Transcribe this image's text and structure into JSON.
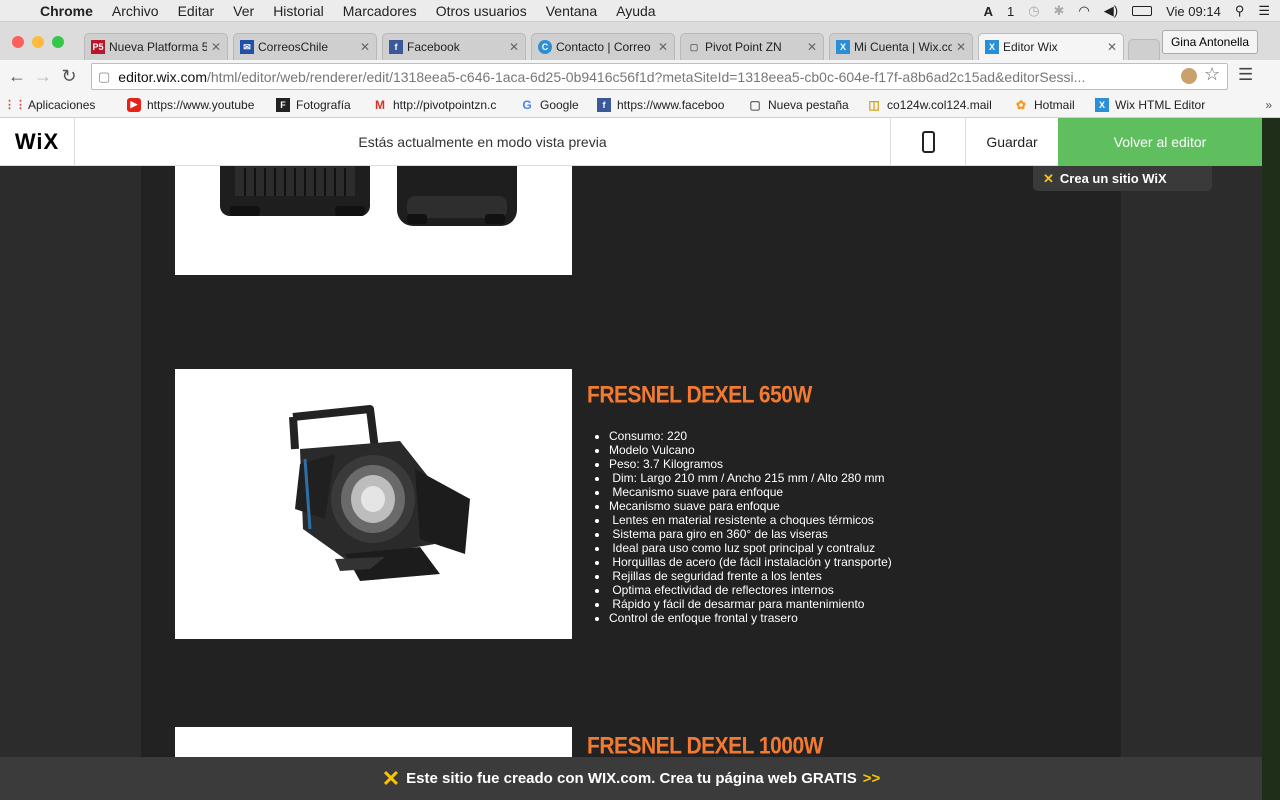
{
  "menubar": {
    "app": "Chrome",
    "items": [
      "Archivo",
      "Editar",
      "Ver",
      "Historial",
      "Marcadores",
      "Otros usuarios",
      "Ventana",
      "Ayuda"
    ],
    "right": {
      "adobe": "1",
      "clock": "Vie 09:14"
    }
  },
  "tabs": [
    {
      "label": "Nueva Platforma 5",
      "fav": "P5",
      "fav_color": "#b8172b"
    },
    {
      "label": "CorreosChile",
      "fav": "✉",
      "fav_color": "#1f4fa8"
    },
    {
      "label": "Facebook",
      "fav": "f",
      "fav_color": "#3b5998"
    },
    {
      "label": "Contacto | Correo",
      "fav": "C",
      "fav_color": "#2a8fd6"
    },
    {
      "label": "Pivot Point ZN",
      "fav": "▢",
      "fav_color": "#888888"
    },
    {
      "label": "Mi Cuenta | Wix.co",
      "fav": "X",
      "fav_color": "#2a8fd6"
    },
    {
      "label": "Editor Wix",
      "fav": "X",
      "fav_color": "#2a8fd6"
    }
  ],
  "profile": "Gina Antonella",
  "url": {
    "host": "editor.wix.com",
    "path": "/html/editor/web/renderer/edit/1318eea5-c646-1aca-6d25-0b9416c56f1d?metaSiteId=1318eea5-cb0c-604e-f17f-a8b6ad2c15ad&editorSessi..."
  },
  "bookmarks": [
    {
      "label": "Aplicaciones",
      "fav": "⋮⋮",
      "fav_color": "#d9483b"
    },
    {
      "label": "https://www.youtube",
      "fav": "▶",
      "fav_color": "#e62117"
    },
    {
      "label": "Fotografía",
      "fav": "F",
      "fav_color": "#222222"
    },
    {
      "label": "http://pivotpointzn.c",
      "fav": "M",
      "fav_color": "#d93025"
    },
    {
      "label": "Google",
      "fav": "G",
      "fav_color": "#4285f4"
    },
    {
      "label": "https://www.faceboo",
      "fav": "f",
      "fav_color": "#3b5998"
    },
    {
      "label": "Nueva pestaña",
      "fav": "▢",
      "fav_color": "#888888"
    },
    {
      "label": "co124w.col124.mail",
      "fav": "◫",
      "fav_color": "#d4a017"
    },
    {
      "label": "Hotmail",
      "fav": "✿",
      "fav_color": "#f29b1d"
    },
    {
      "label": "Wix HTML Editor",
      "fav": "X",
      "fav_color": "#2a8fd6"
    }
  ],
  "wix_bar": {
    "logo": "WiX",
    "preview_text": "Estás actualmente en modo vista previa",
    "save": "Guardar",
    "back": "Volver al editor"
  },
  "crea": "Crea un sitio WiX",
  "products": [
    {
      "title": "FRESNEL DEXEL 650W",
      "specs": [
        "Consumo: 220",
        "Modelo Vulcano",
        "Peso: 3.7 Kilogramos",
        " Dim: Largo 210 mm / Ancho 215 mm / Alto 280 mm",
        " Mecanismo suave para enfoque",
        "Mecanismo suave para enfoque",
        " Lentes en material resistente a choques térmicos",
        " Sistema para giro en 360° de las viseras",
        " Ideal para uso como luz spot principal y contraluz",
        " Horquillas de acero (de fácil instalación y transporte)",
        " Rejillas de seguridad frente a los lentes",
        " Optima efectividad de reflectores internos",
        " Rápido y fácil de desarmar para mantenimiento",
        "Control de enfoque frontal y trasero"
      ]
    },
    {
      "title": "FRESNEL DEXEL 1000W"
    }
  ],
  "banner": {
    "text": "Este sitio fue creado con WIX.com. Crea tu página web GRATIS",
    "arrows": ">>"
  },
  "colors": {
    "accent_orange": "#f47a31",
    "wix_green": "#5fbf5f",
    "wix_yellow": "#f9c400"
  }
}
